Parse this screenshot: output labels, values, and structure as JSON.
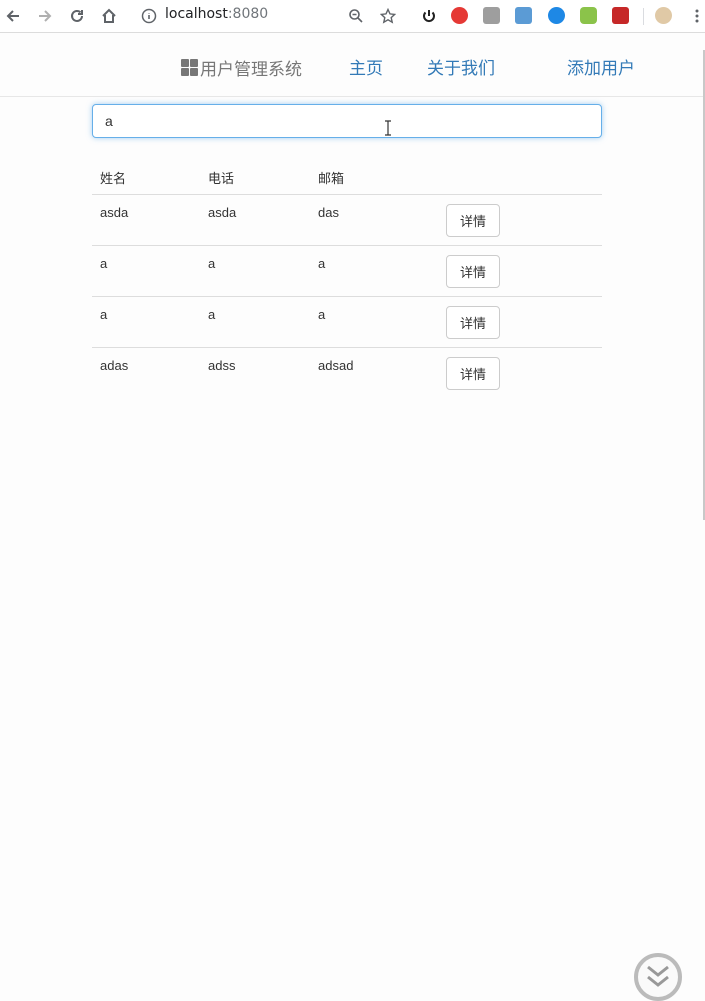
{
  "browser": {
    "url_host": "localhost",
    "url_port": ":8080"
  },
  "navbar": {
    "brand": "用户管理系统",
    "links": [
      "主页",
      "关于我们",
      "添加用户"
    ]
  },
  "search": {
    "value": "a"
  },
  "table": {
    "headers": [
      "姓名",
      "电话",
      "邮箱"
    ],
    "rows": [
      {
        "name": "asda",
        "phone": "asda",
        "email": "das",
        "action": "详情"
      },
      {
        "name": "a",
        "phone": "a",
        "email": "a",
        "action": "详情"
      },
      {
        "name": "a",
        "phone": "a",
        "email": "a",
        "action": "详情"
      },
      {
        "name": "adas",
        "phone": "adss",
        "email": "adsad",
        "action": "详情"
      }
    ]
  },
  "colors": {
    "link": "#337ab7",
    "brand": "#777777",
    "input_focus": "#66afe9"
  }
}
